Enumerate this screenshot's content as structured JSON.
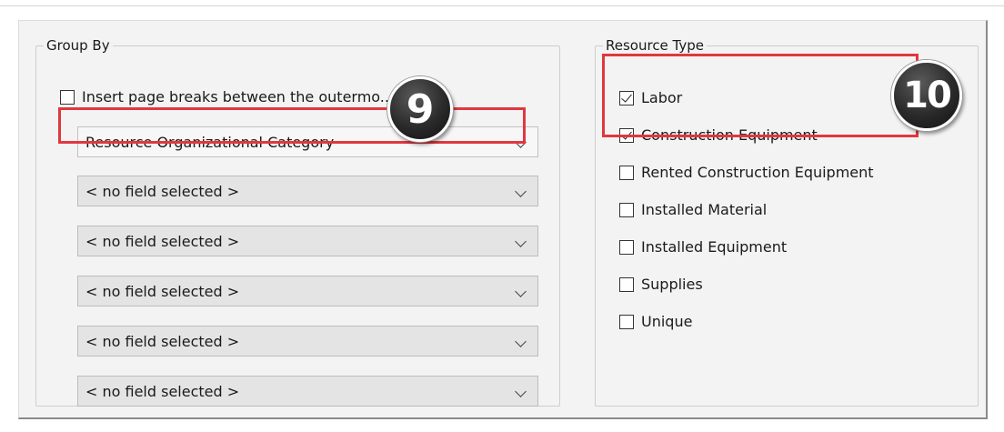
{
  "group_by": {
    "title": "Group By",
    "page_break_checkbox": {
      "label": "Insert page breaks between the outermo... ups",
      "checked": false
    },
    "dropdowns": [
      {
        "value": "Resource Organizational Category"
      },
      {
        "value": "< no field selected >"
      },
      {
        "value": "< no field selected >"
      },
      {
        "value": "< no field selected >"
      },
      {
        "value": "< no field selected >"
      },
      {
        "value": "< no field selected >"
      }
    ],
    "callout": "9"
  },
  "resource_type": {
    "title": "Resource Type",
    "options": [
      {
        "label": "Labor",
        "checked": true
      },
      {
        "label": "Construction Equipment",
        "checked": true
      },
      {
        "label": "Rented Construction Equipment",
        "checked": false
      },
      {
        "label": "Installed Material",
        "checked": false
      },
      {
        "label": "Installed Equipment",
        "checked": false
      },
      {
        "label": "Supplies",
        "checked": false
      },
      {
        "label": "Unique",
        "checked": false
      }
    ],
    "callout": "10"
  },
  "colors": {
    "highlight": "#e0383f",
    "panel_background": "#f3f3f3",
    "dropdown_background": "#e4e4e4"
  }
}
